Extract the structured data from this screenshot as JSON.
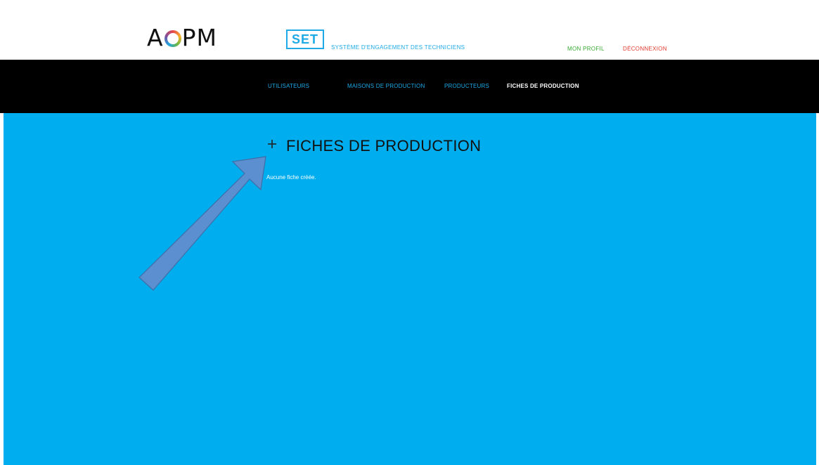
{
  "header": {
    "logo_prefix": "A",
    "logo_suffix": "PM",
    "app_badge": "SET",
    "app_tagline": "SYSTÈME D'ENGAGEMENT DES TECHNICIENS",
    "profile_link": "MON PROFIL",
    "logout_link": "DÉCONNEXION"
  },
  "nav": {
    "items": [
      {
        "label": "UTILISATEURS"
      },
      {
        "label": "MAISONS DE PRODUCTION"
      },
      {
        "label": "PRODUCTEURS"
      },
      {
        "label": "FICHES DE PRODUCTION"
      }
    ],
    "active": "FICHES DE PRODUCTION"
  },
  "main": {
    "add_icon": "plus-icon",
    "title": "FICHES DE PRODUCTION",
    "empty_message": "Aucune fiche créée."
  },
  "annotation": {
    "icon": "arrow-icon",
    "color": "#5b8fcf"
  },
  "colors": {
    "accent_blue": "#1eaae6",
    "content_bg": "#00aeef",
    "nav_bg": "#000000",
    "profile_green": "#3aa935",
    "logout_red": "#e23b32"
  }
}
